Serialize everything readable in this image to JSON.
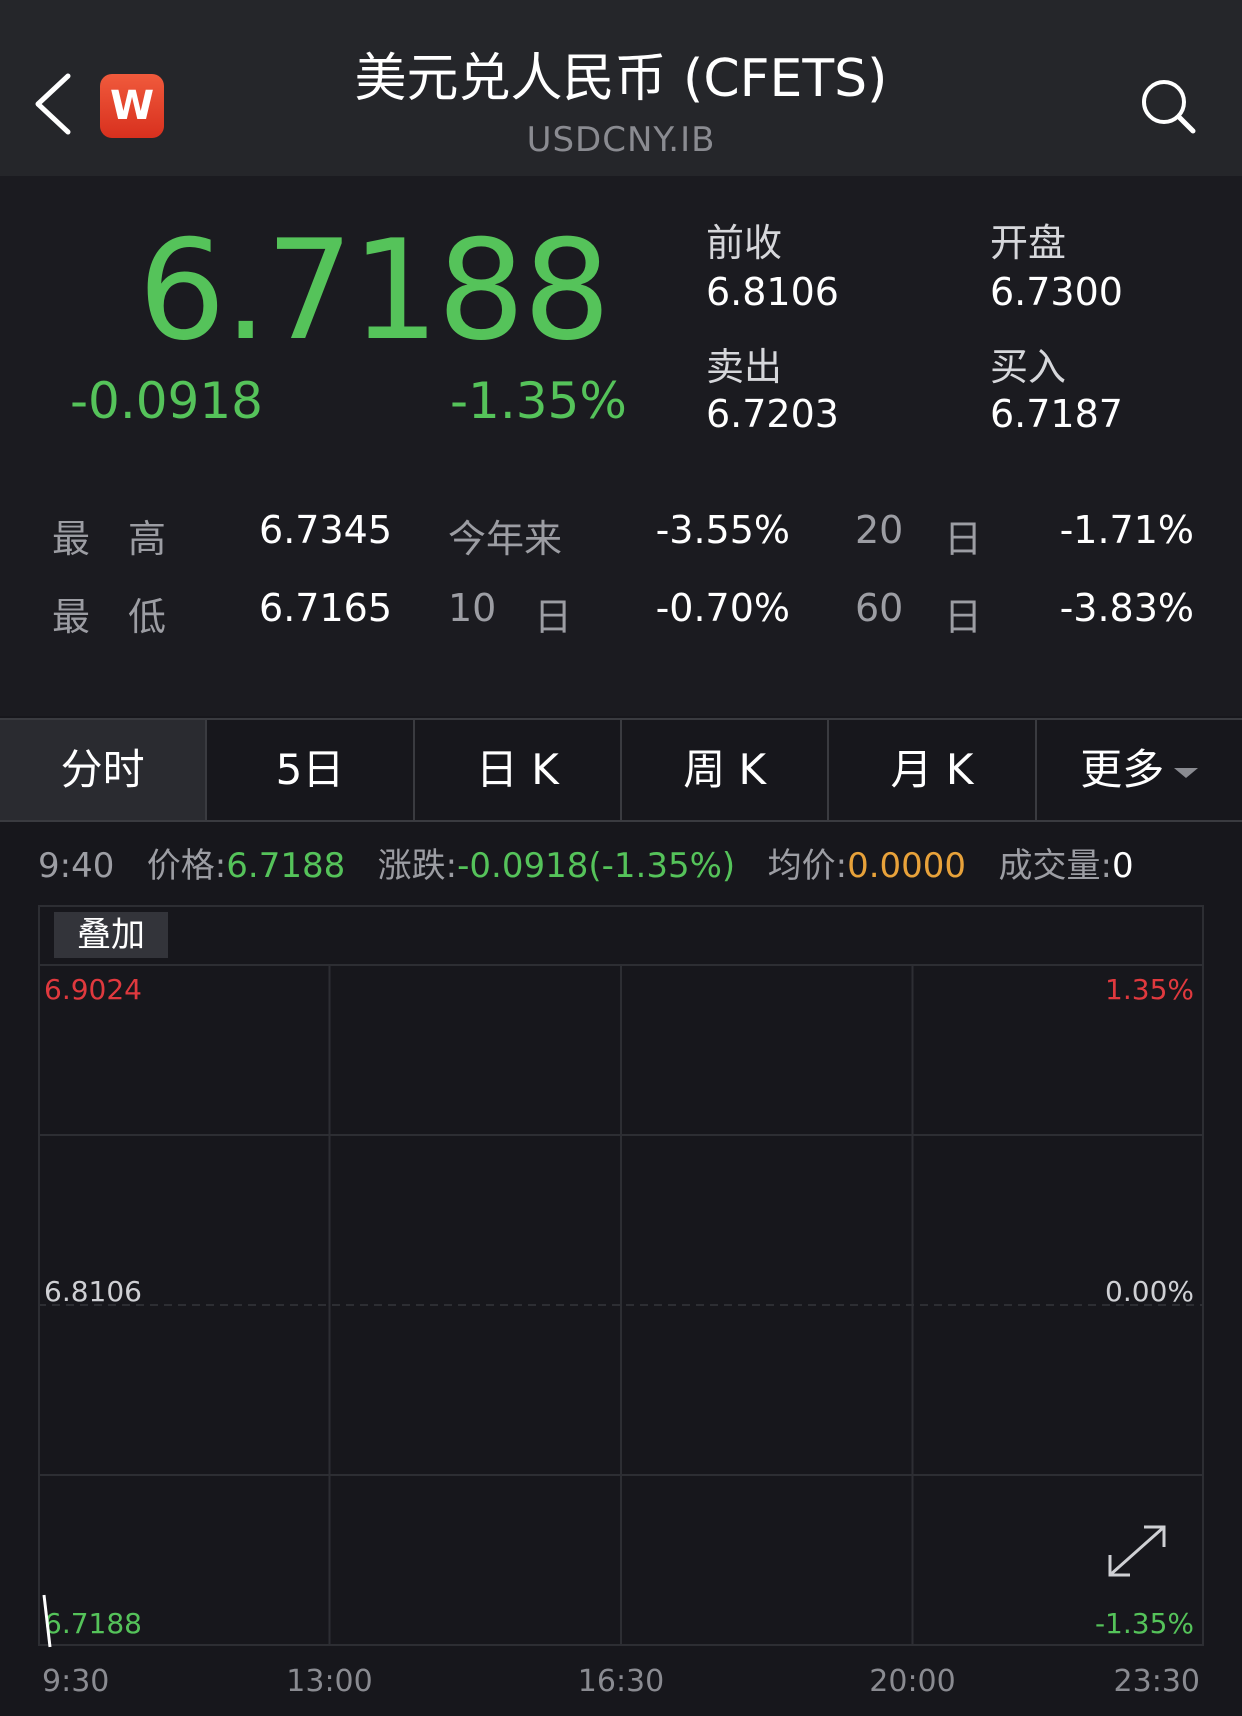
{
  "header": {
    "title": "美元兑人民币 (CFETS)",
    "subtitle": "USDCNY.IB",
    "logo_letter": "W"
  },
  "quote": {
    "price": "6.7188",
    "change": "-0.0918",
    "change_pct": "-1.35%",
    "stats": [
      {
        "label": "前收",
        "value": "6.8106"
      },
      {
        "label": "开盘",
        "value": "6.7300"
      },
      {
        "label": "卖出",
        "value": "6.7203"
      },
      {
        "label": "买入",
        "value": "6.7187"
      }
    ],
    "rows": [
      {
        "a_label": "最　高",
        "a_value": "6.7345",
        "b_label": "今年来",
        "b_value": "-3.55%",
        "c_num": "20",
        "c_unit": "日",
        "c_value": "-1.71%"
      },
      {
        "a_label": "最　低",
        "a_value": "6.7165",
        "b_num": "10",
        "b_unit": "日",
        "b_value": "-0.70%",
        "c_num": "60",
        "c_unit": "日",
        "c_value": "-3.83%"
      }
    ]
  },
  "tabs": [
    {
      "label": "分时",
      "active": true
    },
    {
      "label": "5日"
    },
    {
      "label": "日 K"
    },
    {
      "label": "周 K"
    },
    {
      "label": "月 K"
    },
    {
      "label": "更多"
    }
  ],
  "info": {
    "time": "9:40",
    "price_label": "价格:",
    "price_value": "6.7188",
    "change_label": "涨跌:",
    "change_value": "-0.0918(-1.35%)",
    "avg_label": "均价:",
    "avg_value": "0.0000",
    "volume_label": "成交量:",
    "volume_value": "0"
  },
  "chart": {
    "overlay_label": "叠加",
    "y_left": [
      "6.9024",
      "6.8106",
      "6.7188"
    ],
    "y_right": [
      "1.35%",
      "0.00%",
      "-1.35%"
    ],
    "x_labels": [
      "9:30",
      "13:00",
      "16:30",
      "20:00",
      "23:30"
    ],
    "colors": {
      "up": "#e0393e",
      "flat": "#cfd0d4",
      "down": "#55c35a",
      "grid": "#2d2e33"
    }
  },
  "chart_data": {
    "type": "line",
    "x": [
      "9:30",
      "9:40"
    ],
    "y": [
      6.7188,
      6.7188
    ],
    "ylim": [
      6.7188,
      6.9024
    ],
    "reference": 6.8106,
    "x_ticks": [
      "9:30",
      "13:00",
      "16:30",
      "20:00",
      "23:30"
    ],
    "grid": true
  }
}
